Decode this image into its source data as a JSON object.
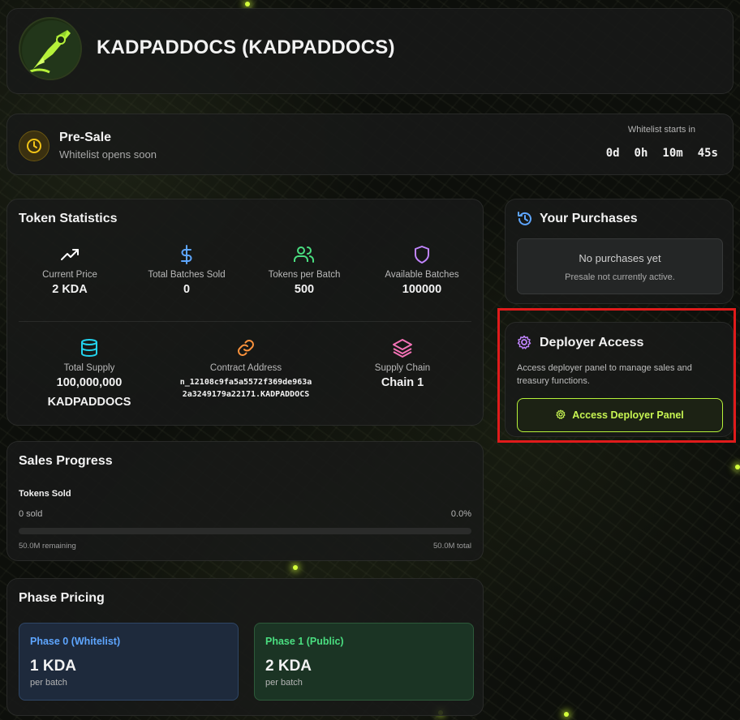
{
  "header": {
    "title": "KADPADDOCS (KADPADDOCS)"
  },
  "presale": {
    "title": "Pre-Sale",
    "subtitle": "Whitelist opens soon",
    "countdown_label": "Whitelist starts in",
    "countdown": {
      "days": "0d",
      "hours": "0h",
      "minutes": "10m",
      "seconds": "45s"
    }
  },
  "stats": {
    "title": "Token Statistics",
    "items": [
      {
        "label": "Current Price",
        "value": "2 KDA",
        "icon": "trending-up-icon"
      },
      {
        "label": "Total Batches Sold",
        "value": "0",
        "icon": "dollar-icon"
      },
      {
        "label": "Tokens per Batch",
        "value": "500",
        "icon": "users-icon"
      },
      {
        "label": "Available Batches",
        "value": "100000",
        "icon": "shield-icon"
      }
    ],
    "supply": {
      "label": "Total Supply",
      "value": "100,000,000",
      "unit": "KADPADDOCS",
      "icon": "database-icon"
    },
    "contract": {
      "label": "Contract Address",
      "value": "n_12108c9fa5a5572f369de963a2a3249179a22171.KADPADDOCS",
      "icon": "link-icon"
    },
    "chain": {
      "label": "Supply Chain",
      "value": "Chain 1",
      "icon": "layers-icon"
    }
  },
  "sales": {
    "title": "Sales Progress",
    "tokens_sold_label": "Tokens Sold",
    "sold": "0 sold",
    "percent": "0.0%",
    "progress_fraction": 0.0,
    "remaining": "50.0M remaining",
    "total": "50.0M total"
  },
  "pricing": {
    "title": "Phase Pricing",
    "phases": [
      {
        "name": "Phase 0 (Whitelist)",
        "price": "1 KDA",
        "unit": "per batch"
      },
      {
        "name": "Phase 1 (Public)",
        "price": "2 KDA",
        "unit": "per batch"
      }
    ]
  },
  "purchases": {
    "title": "Your Purchases",
    "empty_title": "No purchases yet",
    "empty_sub": "Presale not currently active."
  },
  "deployer": {
    "title": "Deployer Access",
    "description": "Access deployer panel to manage sales and treasury functions.",
    "button_label": "Access Deployer Panel"
  },
  "colors": {
    "accent": "#b6f23a",
    "phase0": "#5ea6ff",
    "phase1": "#4ade80",
    "highlight": "#e01b1b"
  }
}
